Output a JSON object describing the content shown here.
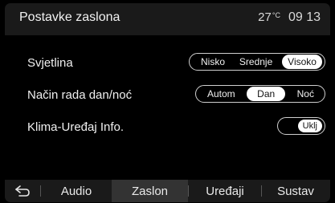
{
  "header": {
    "title": "Postavke zaslona",
    "temperature": "27",
    "temperature_unit": "°C",
    "time": "09 13"
  },
  "settings": {
    "brightness": {
      "label": "Svjetlina",
      "options": [
        "Nisko",
        "Srednje",
        "Visoko"
      ],
      "selected": "Visoko"
    },
    "day_night_mode": {
      "label": "Način rada dan/noć",
      "options": [
        "Autom",
        "Dan",
        "Noć"
      ],
      "selected": "Dan"
    },
    "climate_info": {
      "label": "Klima-Uređaj Info.",
      "state": "Uklj"
    }
  },
  "nav": {
    "back_icon": "back-arrow-icon",
    "items": [
      "Audio",
      "Zaslon",
      "Uređaji",
      "Sustav"
    ],
    "active": "Zaslon"
  }
}
